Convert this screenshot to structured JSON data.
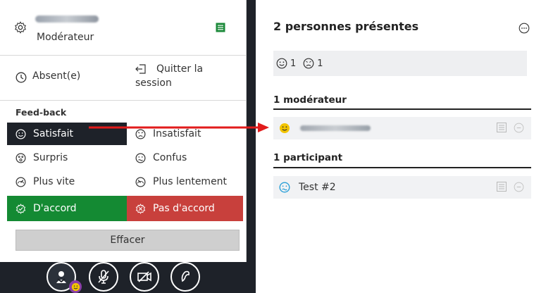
{
  "menu": {
    "role": "Modérateur",
    "away": "Absent(e)",
    "leave_line1": "Quitter la",
    "leave_line2": "session",
    "feedback_title": "Feed-back",
    "feedback": {
      "satisfied": "Satisfait",
      "unsatisfied": "Insatisfait",
      "surprised": "Surpris",
      "confused": "Confus",
      "faster": "Plus vite",
      "slower": "Plus lentement",
      "agree": "D'accord",
      "disagree": "Pas d'accord"
    },
    "clear": "Effacer"
  },
  "panel": {
    "title": "2 personnes présentes",
    "counts": {
      "satisfied": "1",
      "unsatisfied": "1"
    },
    "moderators_title": "1 modérateur",
    "participants_title": "1 participant",
    "participant_name": "Test #2"
  },
  "colors": {
    "dark": "#1e2229",
    "agree": "#148a33",
    "disagree": "#c8403c",
    "arrow": "#e21b1b",
    "emoji_yellow": "#f2c400",
    "emoji_blue": "#2aa0d8"
  }
}
